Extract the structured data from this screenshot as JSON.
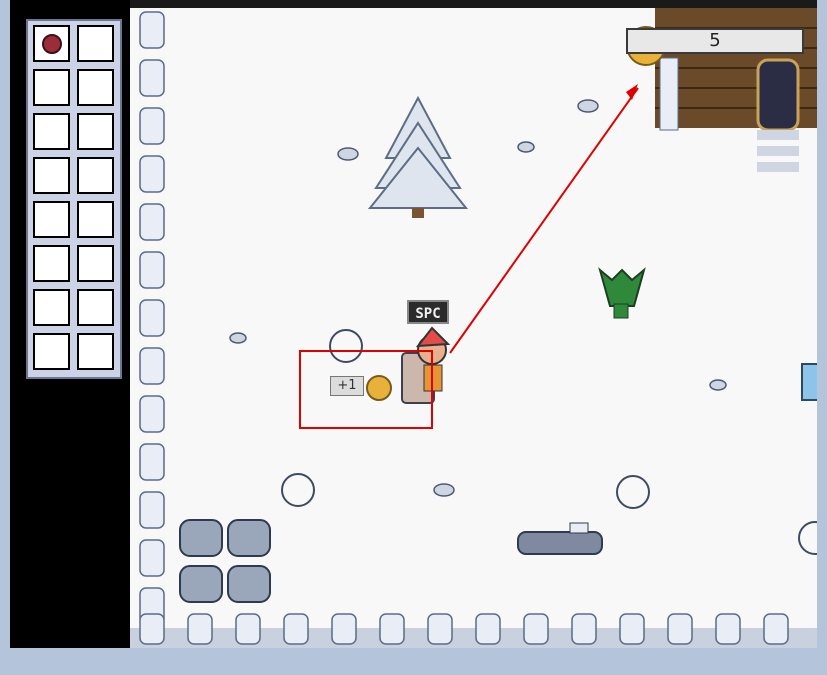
{
  "hud": {
    "coin_count": "5"
  },
  "labels": {
    "interact_key": "SPC",
    "coin_gain": "+1"
  },
  "inventory": {
    "rows": 8,
    "columns": 2,
    "filled_slots": [
      {
        "slot": 0,
        "item": "ornament-icon"
      }
    ]
  },
  "colors": {
    "annotation_red": "#e00000",
    "snow": "#f8f8f8",
    "coin": "#e8b23a"
  }
}
